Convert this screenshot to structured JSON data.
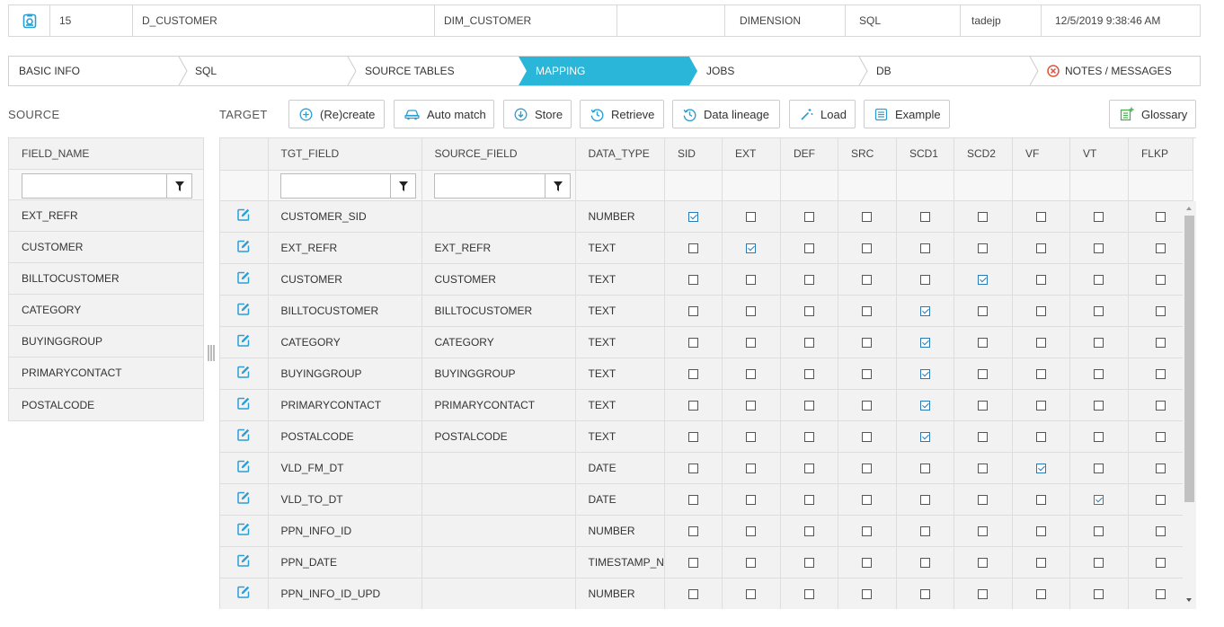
{
  "info": {
    "id": "15",
    "name": "D_CUSTOMER",
    "table": "DIM_CUSTOMER",
    "blank": "",
    "type": "DIMENSION",
    "source_type": "SQL",
    "user": "tadejp",
    "date": "12/5/2019 9:38:46 AM"
  },
  "wizard": {
    "steps": [
      "BASIC INFO",
      "SQL",
      "SOURCE TABLES",
      "MAPPING",
      "JOBS",
      "DB",
      "NOTES / MESSAGES"
    ],
    "active": "MAPPING",
    "active_color": "#29b6d8"
  },
  "source": {
    "label": "SOURCE",
    "header": "FIELD_NAME",
    "filter_value": "",
    "items": [
      "EXT_REFR",
      "CUSTOMER",
      "BILLTOCUSTOMER",
      "CATEGORY",
      "BUYINGGROUP",
      "PRIMARYCONTACT",
      "POSTALCODE"
    ]
  },
  "target": {
    "label": "TARGET",
    "buttons": {
      "recreate": "(Re)create",
      "automatch": "Auto match",
      "store": "Store",
      "retrieve": "Retrieve",
      "lineage": "Data lineage",
      "load": "Load",
      "example": "Example",
      "glossary": "Glossary"
    },
    "columns": [
      "",
      "TGT_FIELD",
      "SOURCE_FIELD",
      "DATA_TYPE",
      "SID",
      "EXT",
      "DEF",
      "SRC",
      "SCD1",
      "SCD2",
      "VF",
      "VT",
      "FLKP"
    ],
    "filters": {
      "tgt_field": "",
      "source_field": ""
    },
    "rows": [
      {
        "tgt": "CUSTOMER_SID",
        "src": "",
        "type": "NUMBER",
        "flags": [
          1,
          0,
          0,
          0,
          0,
          0,
          0,
          0,
          0
        ]
      },
      {
        "tgt": "EXT_REFR",
        "src": "EXT_REFR",
        "type": "TEXT",
        "flags": [
          0,
          1,
          0,
          0,
          0,
          0,
          0,
          0,
          0
        ]
      },
      {
        "tgt": "CUSTOMER",
        "src": "CUSTOMER",
        "type": "TEXT",
        "flags": [
          0,
          0,
          0,
          0,
          0,
          1,
          0,
          0,
          0
        ]
      },
      {
        "tgt": "BILLTOCUSTOMER",
        "src": "BILLTOCUSTOMER",
        "type": "TEXT",
        "flags": [
          0,
          0,
          0,
          0,
          1,
          0,
          0,
          0,
          0
        ]
      },
      {
        "tgt": "CATEGORY",
        "src": "CATEGORY",
        "type": "TEXT",
        "flags": [
          0,
          0,
          0,
          0,
          1,
          0,
          0,
          0,
          0
        ]
      },
      {
        "tgt": "BUYINGGROUP",
        "src": "BUYINGGROUP",
        "type": "TEXT",
        "flags": [
          0,
          0,
          0,
          0,
          1,
          0,
          0,
          0,
          0
        ]
      },
      {
        "tgt": "PRIMARYCONTACT",
        "src": "PRIMARYCONTACT",
        "type": "TEXT",
        "flags": [
          0,
          0,
          0,
          0,
          1,
          0,
          0,
          0,
          0
        ]
      },
      {
        "tgt": "POSTALCODE",
        "src": "POSTALCODE",
        "type": "TEXT",
        "flags": [
          0,
          0,
          0,
          0,
          1,
          0,
          0,
          0,
          0
        ]
      },
      {
        "tgt": "VLD_FM_DT",
        "src": "",
        "type": "DATE",
        "flags": [
          0,
          0,
          0,
          0,
          0,
          0,
          1,
          0,
          0
        ]
      },
      {
        "tgt": "VLD_TO_DT",
        "src": "",
        "type": "DATE",
        "flags": [
          0,
          0,
          0,
          0,
          0,
          0,
          0,
          1,
          0
        ]
      },
      {
        "tgt": "PPN_INFO_ID",
        "src": "",
        "type": "NUMBER",
        "flags": [
          0,
          0,
          0,
          0,
          0,
          0,
          0,
          0,
          0
        ]
      },
      {
        "tgt": "PPN_DATE",
        "src": "",
        "type": "TIMESTAMP_N",
        "flags": [
          0,
          0,
          0,
          0,
          0,
          0,
          0,
          0,
          0
        ]
      },
      {
        "tgt": "PPN_INFO_ID_UPD",
        "src": "",
        "type": "NUMBER",
        "flags": [
          0,
          0,
          0,
          0,
          0,
          0,
          0,
          0,
          0
        ]
      }
    ]
  },
  "colors": {
    "accent": "#29b6d8",
    "icon": "#2a9fd6",
    "error": "#e0533d"
  }
}
